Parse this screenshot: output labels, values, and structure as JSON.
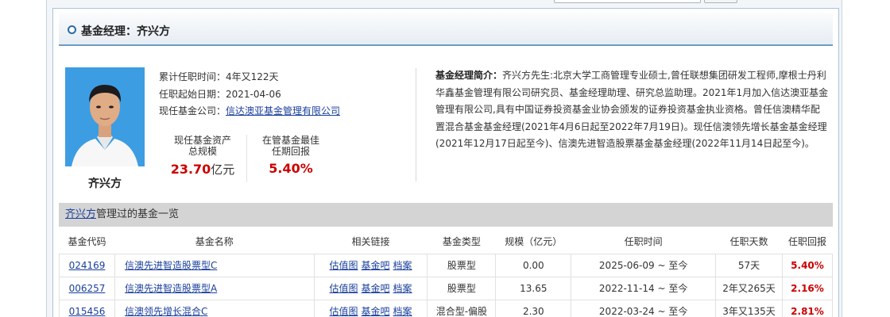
{
  "title": "基金经理：齐兴方",
  "manager": {
    "name": "齐兴方",
    "tenure_label": "累计任职时间：",
    "tenure_value": "4年又122天",
    "start_label": "任职起始日期：",
    "start_value": "2021-04-06",
    "company_label": "现任基金公司：",
    "company_value": "信达澳亚基金管理有限公司"
  },
  "stats": {
    "aum_label_1": "现任基金资产",
    "aum_label_2": "总规模",
    "aum_value": "23.70",
    "aum_unit": "亿元",
    "best_label_1": "在管基金最佳",
    "best_label_2": "任期回报",
    "best_value": "5.40%"
  },
  "bio": {
    "label": "基金经理简介：",
    "text": "齐兴方先生:北京大学工商管理专业硕士,曾任联想集团研发工程师,摩根士丹利华鑫基金管理有限公司研究员、基金经理助理、研究总监助理。2021年1月加入信达澳亚基金管理有限公司,具有中国证券投资基金业协会颁发的证券投资基金执业资格。曾任信澳精华配置混合基金基金经理(2021年4月6日起至2022年7月19日)。现任信澳领先增长基金基金经理(2021年12月17日起至今)、信澳先进智造股票基金基金经理(2022年11月14日起至今)。"
  },
  "fund_list": {
    "title_link": "齐兴方",
    "title_rest": "管理过的基金一览",
    "headers": [
      "基金代码",
      "基金名称",
      "相关链接",
      "基金类型",
      "规模（亿元）",
      "任职时间",
      "任职天数",
      "任职回报"
    ],
    "links": [
      "估值图",
      "基金吧",
      "档案"
    ],
    "rows": [
      {
        "code": "024169",
        "name": "信澳先进智造股票型C",
        "type": "股票型",
        "size": "0.00",
        "period": "2025-06-09 ~ 至今",
        "days": "57天",
        "ret": "5.40%"
      },
      {
        "code": "006257",
        "name": "信澳先进智造股票型A",
        "type": "股票型",
        "size": "13.65",
        "period": "2022-11-14 ~ 至今",
        "days": "2年又265天",
        "ret": "2.16%"
      },
      {
        "code": "015456",
        "name": "信澳领先增长混合C",
        "type": "混合型-偏股",
        "size": "2.30",
        "period": "2022-03-24 ~ 至今",
        "days": "3年又135天",
        "ret": "2.81%"
      }
    ]
  }
}
